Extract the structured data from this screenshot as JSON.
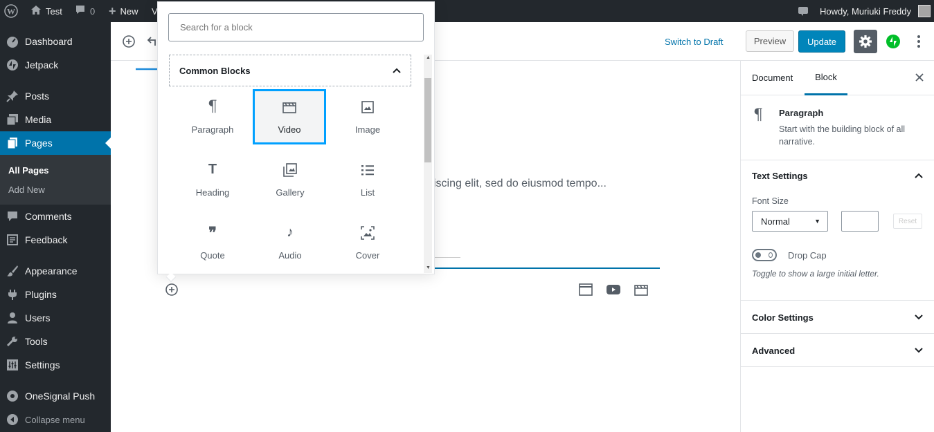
{
  "admin_bar": {
    "site_name": "Test",
    "comments_count": "0",
    "new_label": "New",
    "partial_label": "V",
    "howdy": "Howdy, Muriuki Freddy"
  },
  "sidebar": {
    "items": [
      {
        "label": "Dashboard",
        "icon": "dashboard-icon"
      },
      {
        "label": "Jetpack",
        "icon": "jetpack-icon"
      },
      {
        "label": "Posts",
        "icon": "pin-icon"
      },
      {
        "label": "Media",
        "icon": "media-icon"
      },
      {
        "label": "Pages",
        "icon": "pages-icon"
      },
      {
        "label": "Comments",
        "icon": "comment-icon"
      },
      {
        "label": "Feedback",
        "icon": "feedback-icon"
      },
      {
        "label": "Appearance",
        "icon": "brush-icon"
      },
      {
        "label": "Plugins",
        "icon": "plug-icon"
      },
      {
        "label": "Users",
        "icon": "user-icon"
      },
      {
        "label": "Tools",
        "icon": "wrench-icon"
      },
      {
        "label": "Settings",
        "icon": "settings-icon"
      },
      {
        "label": "OneSignal Push",
        "icon": "onesignal-icon"
      }
    ],
    "submenu": [
      "All Pages",
      "Add New"
    ],
    "collapse": "Collapse menu"
  },
  "toolbar": {
    "switch_draft": "Switch to Draft",
    "preview": "Preview",
    "update": "Update"
  },
  "editor": {
    "paragraph_fragment": "iscing elit, sed do eiusmod tempo..."
  },
  "inserter": {
    "search_placeholder": "Search for a block",
    "section_title": "Common Blocks",
    "blocks": [
      {
        "label": "Paragraph",
        "icon": "paragraph-icon"
      },
      {
        "label": "Video",
        "icon": "video-icon",
        "selected": true
      },
      {
        "label": "Image",
        "icon": "image-icon"
      },
      {
        "label": "Heading",
        "icon": "heading-icon"
      },
      {
        "label": "Gallery",
        "icon": "gallery-icon"
      },
      {
        "label": "List",
        "icon": "list-icon"
      },
      {
        "label": "Quote",
        "icon": "quote-icon"
      },
      {
        "label": "Audio",
        "icon": "audio-icon"
      },
      {
        "label": "Cover",
        "icon": "cover-icon"
      }
    ]
  },
  "panel": {
    "tabs": [
      "Document",
      "Block"
    ],
    "active_tab": "Block",
    "block_name": "Paragraph",
    "block_desc": "Start with the building block of all narrative.",
    "text_settings": "Text Settings",
    "font_size_label": "Font Size",
    "font_size_value": "Normal",
    "reset": "Reset",
    "drop_cap": "Drop Cap",
    "drop_cap_help": "Toggle to show a large initial letter.",
    "color_settings": "Color Settings",
    "advanced": "Advanced"
  },
  "colors": {
    "accent": "#0073aa",
    "highlight": "#00a0ff",
    "admin_dark": "#23282d",
    "jetpack_green": "#00be28"
  }
}
